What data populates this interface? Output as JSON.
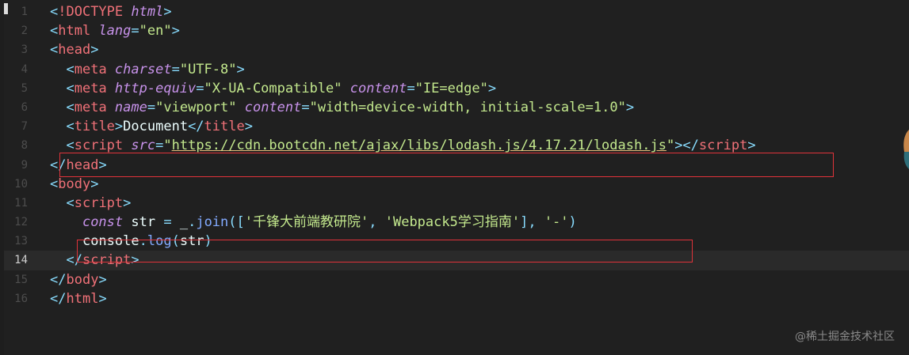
{
  "editor": {
    "active_line": 14,
    "lines": [
      {
        "n": "1",
        "tokens": [
          [
            "punct",
            "<"
          ],
          [
            "tag",
            "!DOCTYPE "
          ],
          [
            "attr",
            "html"
          ],
          [
            "punct",
            ">"
          ]
        ]
      },
      {
        "n": "2",
        "tokens": [
          [
            "punct",
            "<"
          ],
          [
            "tag",
            "html "
          ],
          [
            "attr",
            "lang"
          ],
          [
            "eq",
            "="
          ],
          [
            "str",
            "\"en\""
          ],
          [
            "punct",
            ">"
          ]
        ]
      },
      {
        "n": "3",
        "tokens": [
          [
            "punct",
            "<"
          ],
          [
            "tag",
            "head"
          ],
          [
            "punct",
            ">"
          ]
        ]
      },
      {
        "n": "4",
        "tokens": [
          [
            "plain",
            "  "
          ],
          [
            "punct",
            "<"
          ],
          [
            "tag",
            "meta "
          ],
          [
            "attr",
            "charset"
          ],
          [
            "eq",
            "="
          ],
          [
            "str",
            "\"UTF-8\""
          ],
          [
            "punct",
            ">"
          ]
        ]
      },
      {
        "n": "5",
        "tokens": [
          [
            "plain",
            "  "
          ],
          [
            "punct",
            "<"
          ],
          [
            "tag",
            "meta "
          ],
          [
            "attr",
            "http-equiv"
          ],
          [
            "eq",
            "="
          ],
          [
            "str",
            "\"X-UA-Compatible\""
          ],
          [
            "plain",
            " "
          ],
          [
            "attr",
            "content"
          ],
          [
            "eq",
            "="
          ],
          [
            "str",
            "\"IE=edge\""
          ],
          [
            "punct",
            ">"
          ]
        ]
      },
      {
        "n": "6",
        "tokens": [
          [
            "plain",
            "  "
          ],
          [
            "punct",
            "<"
          ],
          [
            "tag",
            "meta "
          ],
          [
            "attr",
            "name"
          ],
          [
            "eq",
            "="
          ],
          [
            "str",
            "\"viewport\""
          ],
          [
            "plain",
            " "
          ],
          [
            "attr",
            "content"
          ],
          [
            "eq",
            "="
          ],
          [
            "str",
            "\"width=device-width, initial-scale=1.0\""
          ],
          [
            "punct",
            ">"
          ]
        ]
      },
      {
        "n": "7",
        "tokens": [
          [
            "plain",
            "  "
          ],
          [
            "punct",
            "<"
          ],
          [
            "tag",
            "title"
          ],
          [
            "punct",
            ">"
          ],
          [
            "plain",
            "Document"
          ],
          [
            "punct",
            "</"
          ],
          [
            "tag",
            "title"
          ],
          [
            "punct",
            ">"
          ]
        ]
      },
      {
        "n": "8",
        "tokens": [
          [
            "plain",
            "  "
          ],
          [
            "punct",
            "<"
          ],
          [
            "tag",
            "script "
          ],
          [
            "attr",
            "src"
          ],
          [
            "eq",
            "="
          ],
          [
            "str",
            "\""
          ],
          [
            "link",
            "https://cdn.bootcdn.net/ajax/libs/lodash.js/4.17.21/lodash.js"
          ],
          [
            "str",
            "\""
          ],
          [
            "punct",
            "></"
          ],
          [
            "tag",
            "script"
          ],
          [
            "punct",
            ">"
          ]
        ]
      },
      {
        "n": "9",
        "tokens": [
          [
            "punct",
            "</"
          ],
          [
            "tag",
            "head"
          ],
          [
            "punct",
            ">"
          ]
        ]
      },
      {
        "n": "10",
        "tokens": [
          [
            "punct",
            "<"
          ],
          [
            "tag",
            "body"
          ],
          [
            "punct",
            ">"
          ]
        ]
      },
      {
        "n": "11",
        "tokens": [
          [
            "plain",
            "  "
          ],
          [
            "punct",
            "<"
          ],
          [
            "tag",
            "script"
          ],
          [
            "punct",
            ">"
          ]
        ]
      },
      {
        "n": "12",
        "tokens": [
          [
            "plain",
            "    "
          ],
          [
            "kw",
            "const"
          ],
          [
            "var",
            " str "
          ],
          [
            "eq",
            "="
          ],
          [
            "plain",
            " "
          ],
          [
            "var",
            "_"
          ],
          [
            "punct",
            "."
          ],
          [
            "fn",
            "join"
          ],
          [
            "punct",
            "(["
          ],
          [
            "strq",
            "'千锋大前端教研院'"
          ],
          [
            "punct",
            ", "
          ],
          [
            "strq",
            "'Webpack5学习指南'"
          ],
          [
            "punct",
            "], "
          ],
          [
            "strq",
            "'-'"
          ],
          [
            "punct",
            ")"
          ]
        ]
      },
      {
        "n": "13",
        "tokens": [
          [
            "plain",
            "    "
          ],
          [
            "var",
            "console"
          ],
          [
            "punct",
            "."
          ],
          [
            "fn",
            "log"
          ],
          [
            "punct",
            "("
          ],
          [
            "var",
            "str"
          ],
          [
            "punct",
            ")"
          ]
        ]
      },
      {
        "n": "14",
        "tokens": [
          [
            "plain",
            "  "
          ],
          [
            "punct",
            "</"
          ],
          [
            "tag",
            "script"
          ],
          [
            "punct",
            ">"
          ]
        ]
      },
      {
        "n": "15",
        "tokens": [
          [
            "punct",
            "</"
          ],
          [
            "tag",
            "body"
          ],
          [
            "punct",
            ">"
          ]
        ]
      },
      {
        "n": "16",
        "tokens": [
          [
            "punct",
            "</"
          ],
          [
            "tag",
            "html"
          ],
          [
            "punct",
            ">"
          ]
        ]
      }
    ]
  },
  "watermark": "@稀土掘金技术社区",
  "colors": {
    "background": "#202020",
    "highlight_box": "#e0333a"
  }
}
